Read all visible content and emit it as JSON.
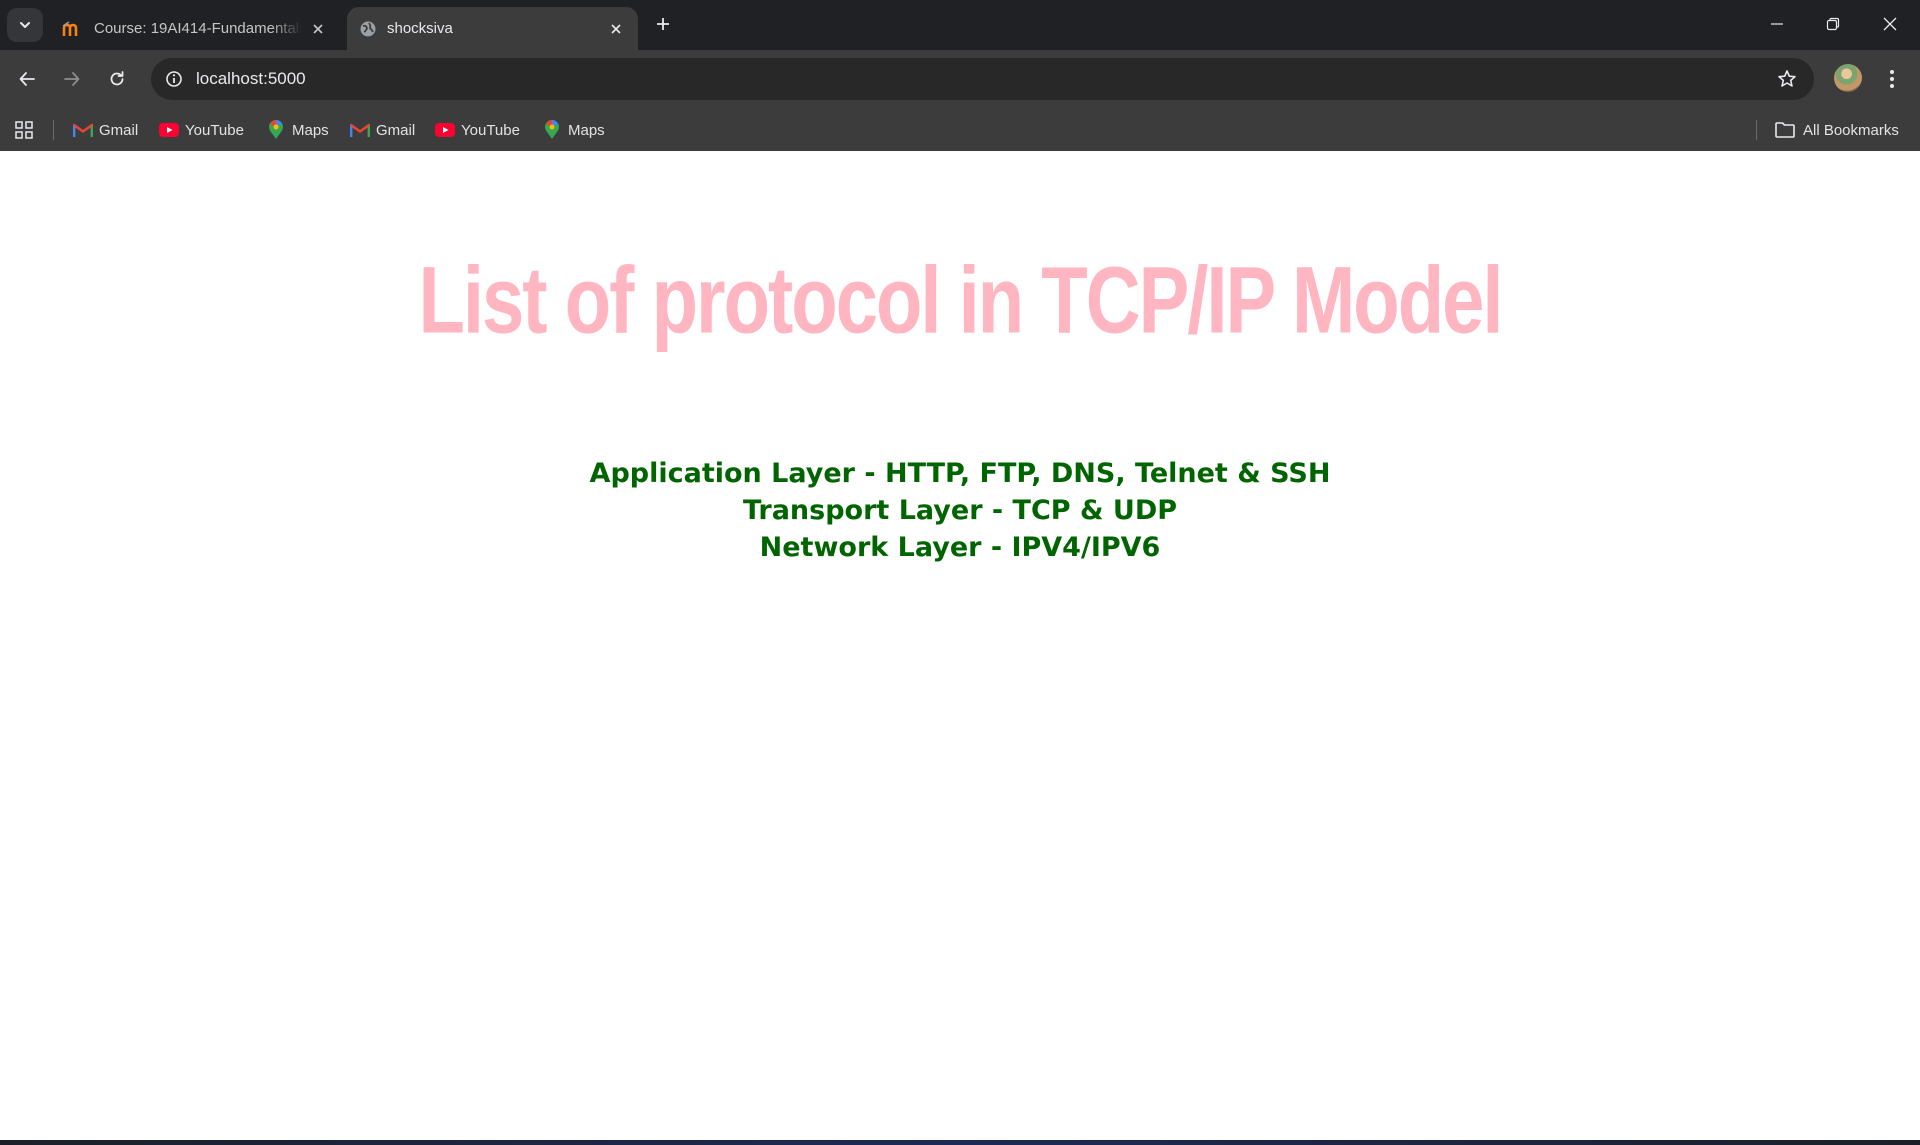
{
  "browser": {
    "tabs": [
      {
        "title": "Course: 19AI414-Fundamentals",
        "icon": "moodle-icon",
        "active": false
      },
      {
        "title": "shocksiva",
        "icon": "globe-icon",
        "active": true
      }
    ],
    "address": {
      "url": "localhost:5000"
    },
    "bookmarks": [
      {
        "label": "Gmail",
        "icon": "gmail-icon"
      },
      {
        "label": "YouTube",
        "icon": "youtube-icon"
      },
      {
        "label": "Maps",
        "icon": "maps-icon"
      },
      {
        "label": "Gmail",
        "icon": "gmail-icon"
      },
      {
        "label": "YouTube",
        "icon": "youtube-icon"
      },
      {
        "label": "Maps",
        "icon": "maps-icon"
      }
    ],
    "all_bookmarks_label": "All Bookmarks"
  },
  "page": {
    "heading": "List of protocol in TCP/IP Model",
    "protocols": [
      "Application Layer - HTTP, FTP, DNS, Telnet & SSH",
      "Transport Layer - TCP & UDP",
      "Network Layer - IPV4/IPV6"
    ],
    "colors": {
      "heading": "#ffb6c1",
      "protocols": "#006400"
    }
  }
}
